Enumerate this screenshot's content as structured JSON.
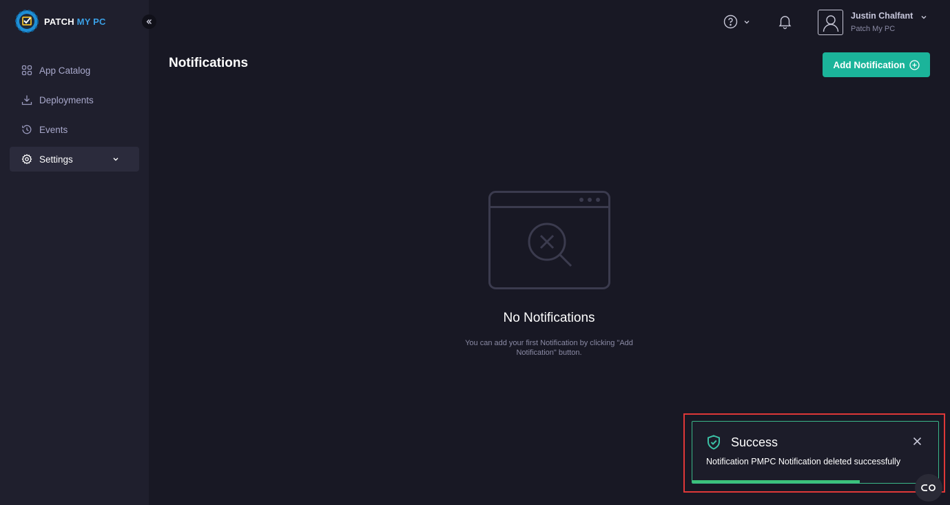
{
  "brand": {
    "name_part1": "PATCH",
    "name_part2": "MY PC"
  },
  "sidebar": {
    "items": [
      {
        "label": "App Catalog",
        "icon": "grid-icon"
      },
      {
        "label": "Deployments",
        "icon": "download-icon"
      },
      {
        "label": "Events",
        "icon": "history-icon"
      },
      {
        "label": "Settings",
        "icon": "gear-icon",
        "active": true
      }
    ]
  },
  "header": {
    "user_name": "Justin Chalfant",
    "user_org": "Patch My PC"
  },
  "page": {
    "title": "Notifications",
    "add_button_label": "Add Notification"
  },
  "empty_state": {
    "title": "No Notifications",
    "description": "You can add your first Notification by clicking \"Add Notification\" button."
  },
  "toast": {
    "title": "Success",
    "message": "Notification PMPC Notification deleted successfully",
    "progress": 0.68
  },
  "colors": {
    "accent": "#1bb49a",
    "success": "#3bc17a",
    "background": "#181824",
    "sidebar": "#1f1f2d",
    "highlight": "#e03838"
  }
}
